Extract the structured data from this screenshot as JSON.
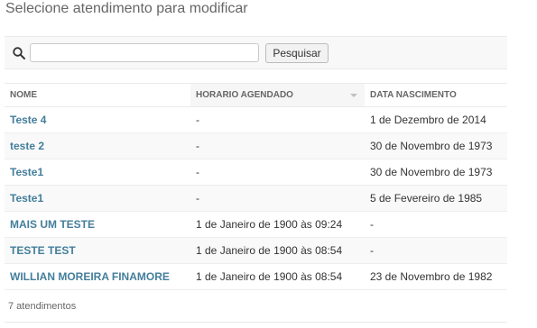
{
  "page": {
    "title": "Selecione atendimento para modificar"
  },
  "search": {
    "value": "",
    "placeholder": "",
    "button_label": "Pesquisar"
  },
  "table": {
    "columns": [
      "NOME",
      "HORARIO AGENDADO",
      "DATA NASCIMENTO"
    ],
    "sorted_column": "HORARIO AGENDADO",
    "rows": [
      {
        "nome": "Teste 4",
        "horario": "-",
        "nascimento": "1 de Dezembro de 2014"
      },
      {
        "nome": "teste 2",
        "horario": "-",
        "nascimento": "30 de Novembro de 1973"
      },
      {
        "nome": "Teste1",
        "horario": "-",
        "nascimento": "30 de Novembro de 1973"
      },
      {
        "nome": "Teste1",
        "horario": "-",
        "nascimento": "5 de Fevereiro de 1985"
      },
      {
        "nome": "MAIS UM TESTE",
        "horario": "1 de Janeiro de 1900 às 09:24",
        "nascimento": "-"
      },
      {
        "nome": "TESTE TEST",
        "horario": "1 de Janeiro de 1900 às 08:54",
        "nascimento": "-"
      },
      {
        "nome": "WILLIAN MOREIRA FINAMORE",
        "horario": "1 de Janeiro de 1900 às 08:54",
        "nascimento": "23 de Novembro de 1982"
      }
    ]
  },
  "result_count": "7 atendimentos",
  "colors": {
    "link": "#447e9b",
    "header_bg": "#f8f8f8",
    "row_alt": "#f9f9f9"
  },
  "icons": {
    "search": "search-icon",
    "sort": "sort-desc-icon"
  }
}
